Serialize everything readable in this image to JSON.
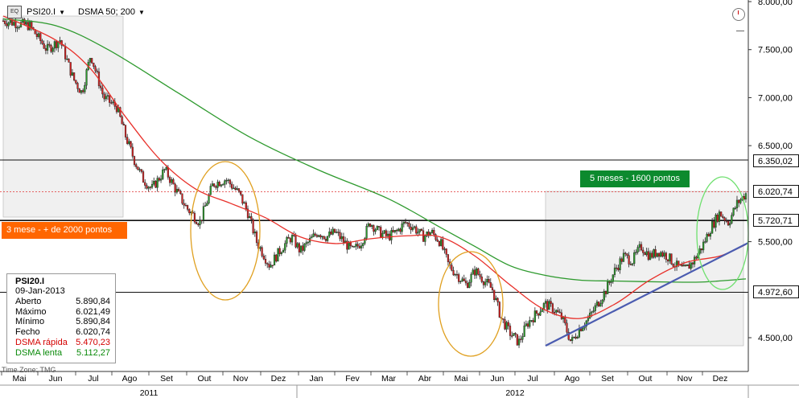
{
  "header": {
    "symbol": "PSI20.I",
    "indicator": "DSMA 50; 200",
    "logo_text": "EQ"
  },
  "annotations": {
    "left_box": "3 mese - + de 2000 pontos",
    "right_box": "5 meses - 1600 pontos"
  },
  "price_tags": [
    {
      "value": 6350.02,
      "label": "6.350,02"
    },
    {
      "value": 6020.74,
      "label": "6.020,74"
    },
    {
      "value": 5720.71,
      "label": "5.720,71"
    },
    {
      "value": 4972.6,
      "label": "4.972,60"
    }
  ],
  "info": {
    "title": "PSI20.I",
    "date": "09-Jan-2013",
    "rows": [
      {
        "label": "Aberto",
        "value": "5.890,84"
      },
      {
        "label": "Máximo",
        "value": "6.021,49"
      },
      {
        "label": "Mínimo",
        "value": "5.890,84"
      },
      {
        "label": "Fecho",
        "value": "6.020,74"
      },
      {
        "label": "DSMA rápida",
        "value": "5.470,23"
      },
      {
        "label": "DSMA lenta",
        "value": "5.112,27"
      }
    ]
  },
  "timezone": "Time Zone: TMG",
  "colors": {
    "fast_ma": "#e8302a",
    "slow_ma": "#2e9a2e",
    "trendline": "#4a5bb0",
    "orange_ellipse": "#e0a020",
    "green_ellipse": "#6ee06e",
    "up_candle": "#2a9a2a",
    "down_candle": "#d42020"
  },
  "chart_data": {
    "type": "candlestick",
    "y_axis": {
      "ylim": [
        4350,
        8000
      ],
      "ticks": [
        {
          "value": 8000,
          "label": "8.000,00"
        },
        {
          "value": 7500,
          "label": "7.500,00"
        },
        {
          "value": 7000,
          "label": "7.000,00"
        },
        {
          "value": 6500,
          "label": "6.500,00"
        },
        {
          "value": 5500,
          "label": "5.500,00"
        },
        {
          "value": 4500,
          "label": "4.500,00"
        }
      ]
    },
    "x_axis": {
      "months": [
        "Mai",
        "Jun",
        "Jul",
        "Ago",
        "Set",
        "Out",
        "Nov",
        "Dez",
        "Jan",
        "Fev",
        "Mar",
        "Abr",
        "Mai",
        "Jun",
        "Jul",
        "Ago",
        "Set",
        "Out",
        "Nov",
        "Dez"
      ],
      "years": [
        "2011",
        "2012"
      ]
    },
    "horizontal_lines": [
      6350.02,
      5720.71,
      4972.6
    ],
    "series": [
      {
        "name": "PSI20.I",
        "price_path": [
          [
            0,
            7800
          ],
          [
            3,
            7750
          ],
          [
            5,
            7500
          ],
          [
            6.5,
            7600
          ],
          [
            8,
            7200
          ],
          [
            9,
            7050
          ],
          [
            10,
            7450
          ],
          [
            11.5,
            7000
          ],
          [
            13,
            6900
          ],
          [
            14,
            6600
          ],
          [
            15,
            6350
          ],
          [
            16,
            6150
          ],
          [
            17,
            6050
          ],
          [
            18.5,
            6250
          ],
          [
            20,
            6000
          ],
          [
            21,
            5850
          ],
          [
            22.5,
            5700
          ],
          [
            24,
            6100
          ],
          [
            25.5,
            6150
          ],
          [
            27,
            6000
          ],
          [
            28,
            5800
          ],
          [
            29,
            5500
          ],
          [
            30.5,
            5250
          ],
          [
            32,
            5450
          ],
          [
            33,
            5550
          ],
          [
            34,
            5400
          ],
          [
            35,
            5500
          ],
          [
            36,
            5600
          ],
          [
            37,
            5550
          ],
          [
            38,
            5600
          ],
          [
            39,
            5500
          ],
          [
            40,
            5400
          ],
          [
            41,
            5500
          ],
          [
            42,
            5700
          ],
          [
            43,
            5600
          ],
          [
            44,
            5550
          ],
          [
            45,
            5600
          ],
          [
            46,
            5700
          ],
          [
            47,
            5650
          ],
          [
            48,
            5550
          ],
          [
            49,
            5600
          ],
          [
            50,
            5500
          ],
          [
            51,
            5250
          ],
          [
            52,
            5150
          ],
          [
            53,
            5050
          ],
          [
            54,
            5200
          ],
          [
            55,
            5100
          ],
          [
            56,
            5000
          ],
          [
            57,
            4700
          ],
          [
            58,
            4550
          ],
          [
            59,
            4450
          ],
          [
            60,
            4650
          ],
          [
            61,
            4750
          ],
          [
            62,
            4850
          ],
          [
            63,
            4800
          ],
          [
            64,
            4700
          ],
          [
            65,
            4450
          ],
          [
            66,
            4600
          ],
          [
            67,
            4700
          ],
          [
            68,
            4850
          ],
          [
            69,
            5000
          ],
          [
            70,
            5200
          ],
          [
            71,
            5350
          ],
          [
            72,
            5300
          ],
          [
            73,
            5450
          ],
          [
            74,
            5350
          ],
          [
            75,
            5400
          ],
          [
            76,
            5350
          ],
          [
            77,
            5250
          ],
          [
            78,
            5200
          ],
          [
            79,
            5300
          ],
          [
            80,
            5450
          ],
          [
            81,
            5650
          ],
          [
            82,
            5800
          ],
          [
            83,
            5700
          ],
          [
            84,
            5900
          ],
          [
            85,
            6000
          ]
        ],
        "x_range": [
          0,
          85
        ]
      },
      {
        "name": "DSMA rápida",
        "path": [
          [
            0,
            7850
          ],
          [
            6,
            7600
          ],
          [
            10,
            7300
          ],
          [
            14,
            6800
          ],
          [
            18,
            6350
          ],
          [
            22,
            6050
          ],
          [
            26,
            5900
          ],
          [
            30,
            5750
          ],
          [
            34,
            5550
          ],
          [
            38,
            5480
          ],
          [
            42,
            5530
          ],
          [
            46,
            5560
          ],
          [
            50,
            5550
          ],
          [
            54,
            5350
          ],
          [
            58,
            5050
          ],
          [
            62,
            4790
          ],
          [
            66,
            4700
          ],
          [
            70,
            4850
          ],
          [
            74,
            5100
          ],
          [
            78,
            5280
          ],
          [
            82,
            5350
          ],
          [
            85,
            5470
          ]
        ]
      },
      {
        "name": "DSMA lenta",
        "path": [
          [
            0,
            7820
          ],
          [
            6,
            7750
          ],
          [
            12,
            7500
          ],
          [
            20,
            7050
          ],
          [
            28,
            6600
          ],
          [
            36,
            6250
          ],
          [
            44,
            5950
          ],
          [
            50,
            5650
          ],
          [
            54,
            5450
          ],
          [
            58,
            5250
          ],
          [
            62,
            5150
          ],
          [
            66,
            5100
          ],
          [
            70,
            5090
          ],
          [
            76,
            5080
          ],
          [
            80,
            5080
          ],
          [
            85,
            5112
          ]
        ]
      }
    ]
  }
}
